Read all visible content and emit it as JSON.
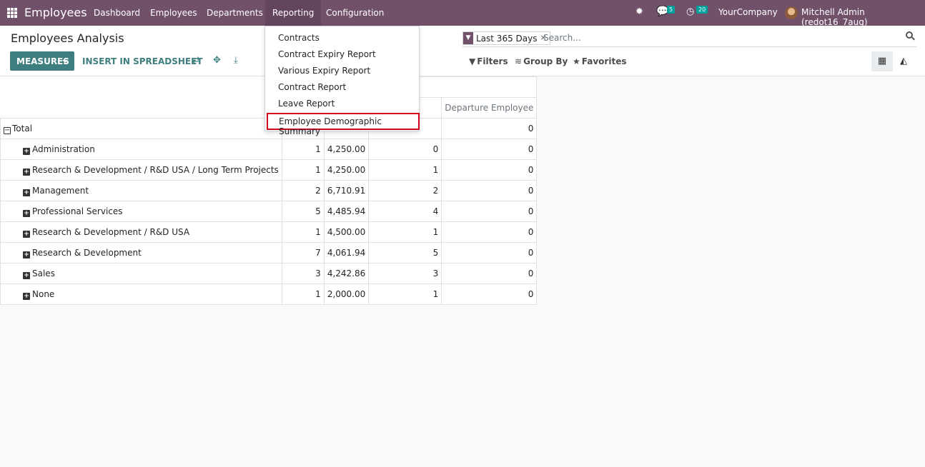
{
  "navbar": {
    "brand": "Employees",
    "menu": [
      "Dashboard",
      "Employees",
      "Departments",
      "Reporting",
      "Configuration"
    ],
    "chat_count": "5",
    "activity_count": "20",
    "company": "YourCompany",
    "user": "Mitchell Admin (redot16_7aug)",
    "colors": {
      "navbar": "#71506a",
      "accent": "#3f7e7e",
      "badge": "#00a09d"
    }
  },
  "control_panel": {
    "title": "Employees Analysis",
    "measures_label": "MEASURES",
    "insert_label": "INSERT IN SPREADSHEET",
    "search": {
      "facet": "Last 365 Days",
      "placeholder": "Search..."
    },
    "filters_label": "Filters",
    "groupby_label": "Group By",
    "favorites_label": "Favorites"
  },
  "dropdown": {
    "items": [
      "Contracts",
      "Contract Expiry Report",
      "Various Expiry Report",
      "Contract Report",
      "Leave Report",
      "Employee Demographic Summary"
    ],
    "highlighted_index": 5
  },
  "pivot": {
    "col_group_fragment": "T",
    "col_headers": [
      "Em",
      "",
      "",
      "Departure Employee"
    ],
    "total_row": {
      "label": "Total",
      "fragment": "",
      "departure": "0"
    },
    "rows": [
      {
        "label": "Administration",
        "count": "1",
        "wage": "4,250.00",
        "c3": "0",
        "departure": "0"
      },
      {
        "label": "Research & Development / R&D USA / Long Term Projects",
        "count": "1",
        "wage": "4,250.00",
        "c3": "1",
        "departure": "0"
      },
      {
        "label": "Management",
        "count": "2",
        "wage": "6,710.91",
        "c3": "2",
        "departure": "0"
      },
      {
        "label": "Professional Services",
        "count": "5",
        "wage": "4,485.94",
        "c3": "4",
        "departure": "0"
      },
      {
        "label": "Research & Development / R&D USA",
        "count": "1",
        "wage": "4,500.00",
        "c3": "1",
        "departure": "0"
      },
      {
        "label": "Research & Development",
        "count": "7",
        "wage": "4,061.94",
        "c3": "5",
        "departure": "0"
      },
      {
        "label": "Sales",
        "count": "3",
        "wage": "4,242.86",
        "c3": "3",
        "departure": "0"
      },
      {
        "label": "None",
        "count": "1",
        "wage": "2,000.00",
        "c3": "1",
        "departure": "0"
      }
    ]
  }
}
